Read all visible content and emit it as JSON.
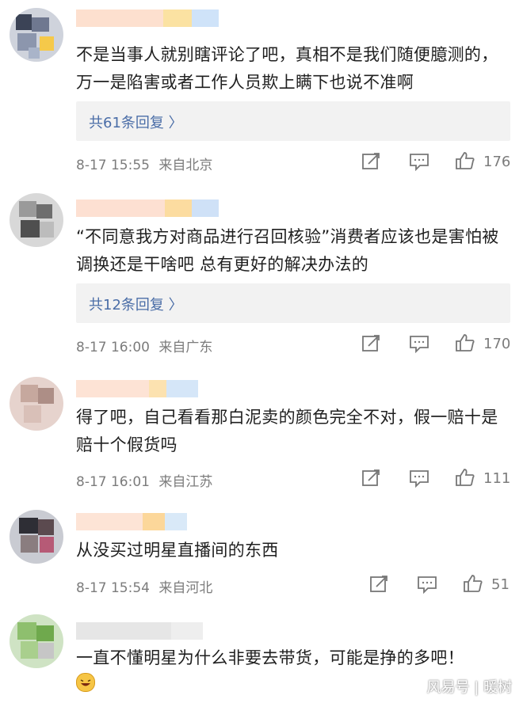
{
  "comments": [
    {
      "text": "不是当事人就别瞎评论了吧，真相不是我们随便臆测的，万一是陷害或者工作人员欺上瞒下也说不准啊",
      "replies": "共61条回复 〉",
      "time": "8-17 15:55",
      "location": "来自北京",
      "likes": "176"
    },
    {
      "text": "“不同意我方对商品进行召回核验”消费者应该也是害怕被调换还是干啥吧 总有更好的解决办法的",
      "replies": "共12条回复 〉",
      "time": "8-17 16:00",
      "location": "来自广东",
      "likes": "170"
    },
    {
      "text": "得了吧，自己看看那白泥卖的颜色完全不对，假一赔十是赔十个假货吗",
      "time": "8-17 16:01",
      "location": "来自江苏",
      "likes": "111"
    },
    {
      "text": "从没买过明星直播间的东西",
      "time": "8-17 15:54",
      "location": "来自河北",
      "likes": "51"
    },
    {
      "text": "一直不懂明星为什么非要去带货，可能是挣的多吧！"
    }
  ],
  "icons": {
    "repost": "repost-icon",
    "comment": "comment-icon",
    "like": "thumbs-up-icon",
    "emoji": "laughing-emoji-icon"
  },
  "colors": {
    "link": "#4a6da7",
    "meta": "#7c7c7c",
    "reply_bg": "#f2f2f2"
  },
  "watermark": "风易号 | 暖树"
}
